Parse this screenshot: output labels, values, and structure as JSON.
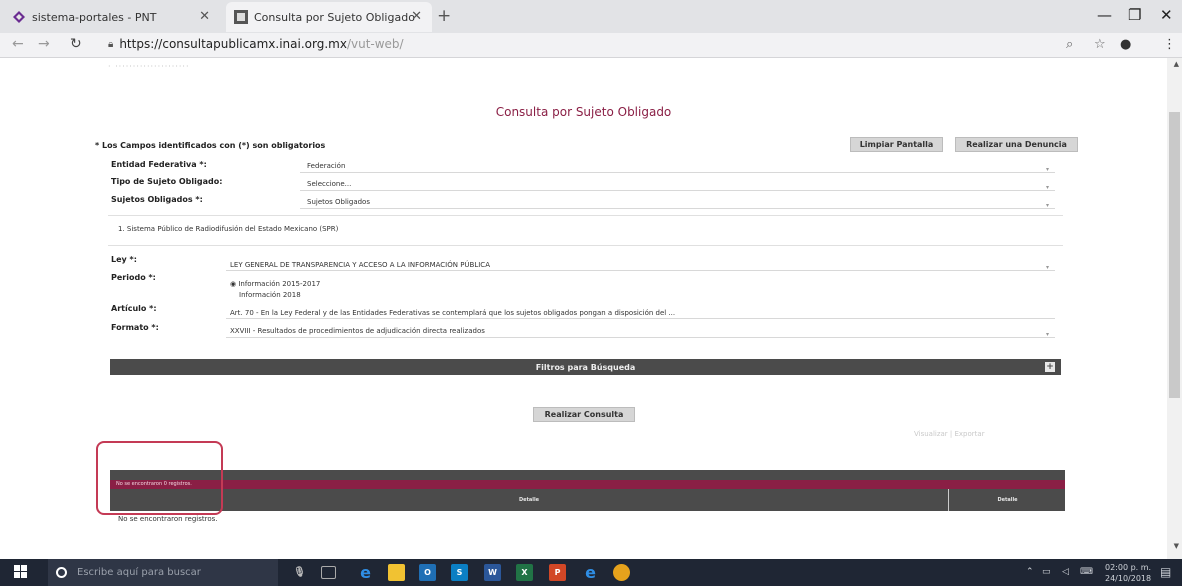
{
  "browser": {
    "tabs": [
      {
        "title": "sistema-portales - PNT"
      },
      {
        "title": "Consulta por Sujeto Obligado"
      }
    ],
    "url_host": "https://consultapublicamx.inai.org.mx",
    "url_path": "/vut-web/"
  },
  "page": {
    "top_faded": "· ·····················",
    "title": "Consulta por Sujeto Obligado",
    "required_note": "* Los Campos identificados con (*) son obligatorios",
    "buttons": {
      "clear": "Limpiar Pantalla",
      "report": "Realizar una Denuncia"
    },
    "fields": {
      "entidad": {
        "label": "Entidad Federativa *:",
        "value": "Federación"
      },
      "tipo": {
        "label": "Tipo de Sujeto Obligado:",
        "value": "Seleccione..."
      },
      "sujetos": {
        "label": "Sujetos Obligados *:",
        "value": "Sujetos Obligados"
      },
      "selected_subject": "1. Sistema Público de Radiodifusión del Estado Mexicano (SPR)",
      "ley": {
        "label": "Ley *:",
        "value": "LEY GENERAL DE TRANSPARENCIA Y ACCESO A LA INFORMACIÓN PÚBLICA"
      },
      "periodo": {
        "label": "Periodo *:",
        "option1": "Información 2015-2017",
        "option2": "Información 2018"
      },
      "articulo": {
        "label": "Artículo *:",
        "value": "Art. 70 - En la Ley Federal y de las Entidades Federativas se contemplará que los sujetos obligados pongan a disposición del ..."
      },
      "formato": {
        "label": "Formato *:",
        "value": "XXVIII - Resultados de procedimientos de adjudicación directa realizados"
      }
    },
    "filters_label": "Filtros para Búsqueda",
    "consult_button": "Realizar Consulta",
    "faded_actions": "Visualizar   |  Exportar",
    "results": {
      "count_text": "No se encontraron 0 registros.",
      "col_detalle": "Detalle",
      "col_detalle2": "Detalle",
      "empty_text": "No se encontraron registros."
    }
  },
  "taskbar": {
    "search_placeholder": "Escribe aquí para buscar",
    "time": "02:00 p. m.",
    "date": "24/10/2018"
  }
}
